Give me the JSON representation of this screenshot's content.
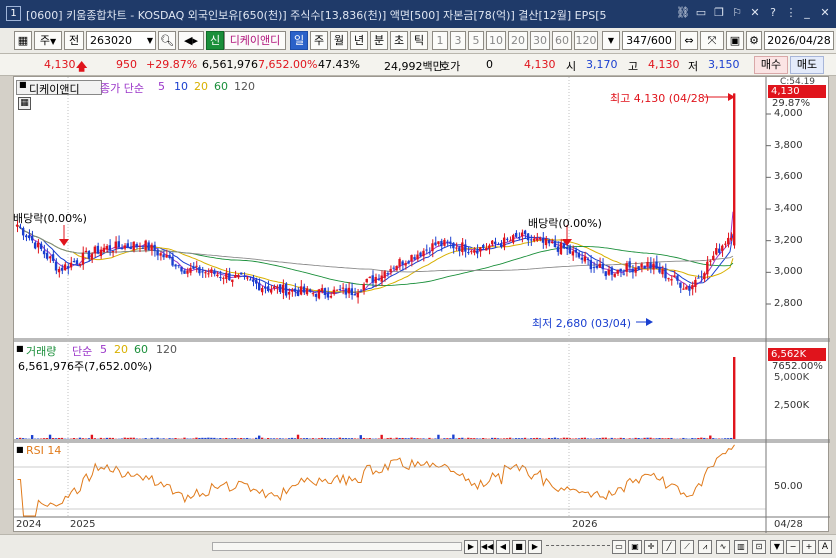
{
  "window": {
    "app_number": "1",
    "title": "[0600] 키움종합차트 - KOSDAQ 외국인보유[650(천)] 주식수[13,836(천)] 액면[500] 자본금[78(억)] 결산[12월] EPS[5"
  },
  "toolbar": {
    "type_label": "주",
    "prev_label": "전",
    "code": "263020",
    "new_badge": "신",
    "stock_name": "디케이앤디",
    "periods": [
      "일",
      "주",
      "월",
      "년",
      "분",
      "초",
      "틱"
    ],
    "active_period": "일",
    "intervals": [
      "1",
      "3",
      "5",
      "10",
      "20",
      "30",
      "60",
      "120"
    ],
    "count": "347/600",
    "date": "2026/04/28"
  },
  "quote": {
    "price": "4,130",
    "change": "950",
    "change_pct": "+29.87%",
    "volume": "6,561,976",
    "volume_ratio": "7,652.00%",
    "turnover": "47.43%",
    "value": "24,992백만",
    "hoga_label": "호가",
    "hoga_value": "0",
    "hoga_price": "4,130",
    "open_label": "시",
    "open": "3,170",
    "high_label": "고",
    "high": "4,130",
    "low_label": "저",
    "low": "3,150",
    "buy_label": "매수",
    "sell_label": "매도"
  },
  "price_panel": {
    "stock_label": "디케이앤디",
    "ma_title": "종가 단순",
    "ma_periods": [
      "5",
      "10",
      "20",
      "60",
      "120"
    ],
    "ma_colors": [
      "#9b36c9",
      "#1a3fd0",
      "#d8b000",
      "#1a8f3a",
      "#8a8a8a"
    ],
    "price_tag": "4,130",
    "pct_tag": "29.87%",
    "partial_tag": "C:54.19",
    "high_annotation": "최고 4,130 (04/28)",
    "low_annotation": "최저 2,680 (03/04)",
    "dividend_label_1": "배당락(0.00%)",
    "dividend_label_2": "배당락(0.00%)"
  },
  "volume_panel": {
    "title": "거래량",
    "ma_title": "단순",
    "ma_periods": [
      "5",
      "20",
      "60",
      "120"
    ],
    "readout": "6,561,976주(7,652.00%)",
    "tag": "6,562K",
    "tag_pct": "7652.00%",
    "partial_tag": "5,000K",
    "tick_2500": "2,500K"
  },
  "rsi_panel": {
    "title": "RSI 14",
    "tick_50": "50.00"
  },
  "xaxis": {
    "labels": [
      "2024",
      "2025",
      "2026"
    ],
    "last_date": "04/28"
  },
  "price_axis": {
    "ticks": [
      "4,000",
      "3,800",
      "3,600",
      "3,400",
      "3,200",
      "3,000",
      "2,800"
    ]
  },
  "colors": {
    "up": "#e0141c",
    "down": "#1a3fd0",
    "rsi": "#e07a1a",
    "title_bg": "#1f3a69"
  },
  "chart_data": {
    "type": "candlestick",
    "period": "daily",
    "bars_shown": 347,
    "ylim": [
      2680,
      4130
    ],
    "y_ticks": [
      2800,
      3000,
      3200,
      3400,
      3600,
      3800,
      4000
    ],
    "last": {
      "date": "2026/04/28",
      "open": 3170,
      "high": 4130,
      "low": 3150,
      "close": 4130,
      "volume": 6561976
    },
    "high_point": {
      "date": "04/28",
      "value": 4130
    },
    "low_point": {
      "date": "03/04",
      "value": 2680
    },
    "close_trend": [
      {
        "x": "2024-11",
        "y": 3300
      },
      {
        "x": "2024-12",
        "y": 3020
      },
      {
        "x": "2025-01",
        "y": 3150
      },
      {
        "x": "2025-02",
        "y": 3180
      },
      {
        "x": "2025-03",
        "y": 3020
      },
      {
        "x": "2025-04",
        "y": 2980
      },
      {
        "x": "2025-05",
        "y": 2900
      },
      {
        "x": "2025-06",
        "y": 2870
      },
      {
        "x": "2025-07",
        "y": 2880
      },
      {
        "x": "2025-08",
        "y": 3050
      },
      {
        "x": "2025-09",
        "y": 3180
      },
      {
        "x": "2025-10",
        "y": 3150
      },
      {
        "x": "2025-11",
        "y": 3220
      },
      {
        "x": "2025-12",
        "y": 3150
      },
      {
        "x": "2026-01",
        "y": 3000
      },
      {
        "x": "2026-02",
        "y": 3050
      },
      {
        "x": "2026-03",
        "y": 2900
      },
      {
        "x": "2026-04",
        "y": 3250
      },
      {
        "x": "2026-04-28",
        "y": 4130
      }
    ],
    "rsi_ylim": [
      0,
      100
    ],
    "rsi_tick": 50
  }
}
